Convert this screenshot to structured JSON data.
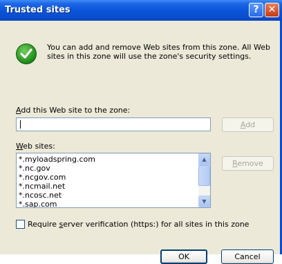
{
  "window": {
    "title": "Trusted sites"
  },
  "info_text": "You can add and remove Web sites from this zone. All Web sites in this zone will use the zone's security settings.",
  "add_label": {
    "pre": "",
    "key": "A",
    "post": "dd this Web site to the zone:"
  },
  "add_value": "",
  "add_button": {
    "pre": "",
    "key": "A",
    "post": "dd"
  },
  "websites_label": {
    "pre": "",
    "key": "W",
    "post": "eb sites:"
  },
  "websites": [
    "*.myloadspring.com",
    "*.nc.gov",
    "*.ncgov.com",
    "*.ncmail.net",
    "*.ncosc.net",
    "*.sap.com"
  ],
  "remove_button": {
    "pre": "",
    "key": "R",
    "post": "emove"
  },
  "require_checkbox": {
    "pre": "Require ",
    "key": "s",
    "post": "erver verification (https:) for all sites in this zone",
    "checked": false
  },
  "ok_label": "OK",
  "cancel_label": "Cancel"
}
